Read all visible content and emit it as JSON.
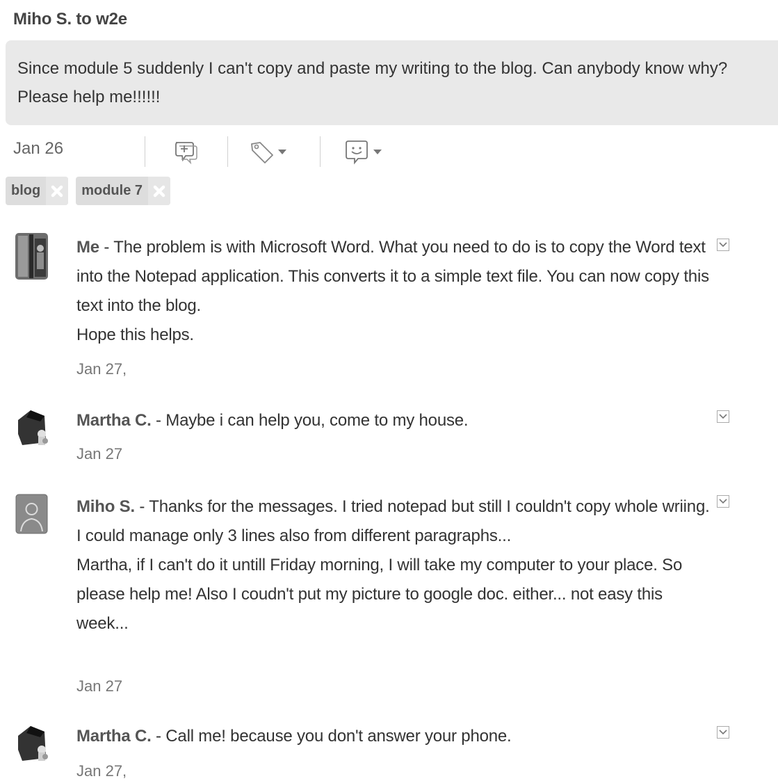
{
  "header": {
    "title": "Miho S. to w2e"
  },
  "post": {
    "text": "Since module 5 suddenly I can't copy and paste my writing to the blog. Can anybody know why? Please help me!!!!!!",
    "date": "Jan 26",
    "tags": [
      {
        "label": "blog"
      },
      {
        "label": "module 7"
      }
    ]
  },
  "icons": {
    "comment": "add-comment-icon",
    "tag": "tag-icon",
    "emoticon": "emoticon-icon",
    "remove": "remove-tag-icon",
    "menu": "chevron-down-icon"
  },
  "comments": [
    {
      "author": "Me",
      "sep": " - ",
      "text": "The problem is with Microsoft Word. What you need to do is to copy the Word text into the Notepad application. This converts it to a simple text file. You can now copy this text into the blog.",
      "text2": "Hope this helps.",
      "date": "Jan 27,"
    },
    {
      "author": "Martha C.",
      "sep": " - ",
      "text": "Maybe i can help you, come to my house.",
      "date": "Jan 27"
    },
    {
      "author": "Miho S.",
      "sep": " - ",
      "text": "Thanks for the messages. I tried notepad but still I couldn't copy whole wriing. I could manage only 3 lines also from different paragraphs...",
      "text2": "Martha, if I can't do it untill Friday morning, I will take my computer to your place. So please help me! Also I coudn't put my picture to google doc. either... not easy this week...",
      "date": "Jan 27"
    },
    {
      "author": "Martha C.",
      "sep": " - ",
      "text": "Call me! because you don't answer your phone.",
      "date": "Jan 27,"
    }
  ]
}
